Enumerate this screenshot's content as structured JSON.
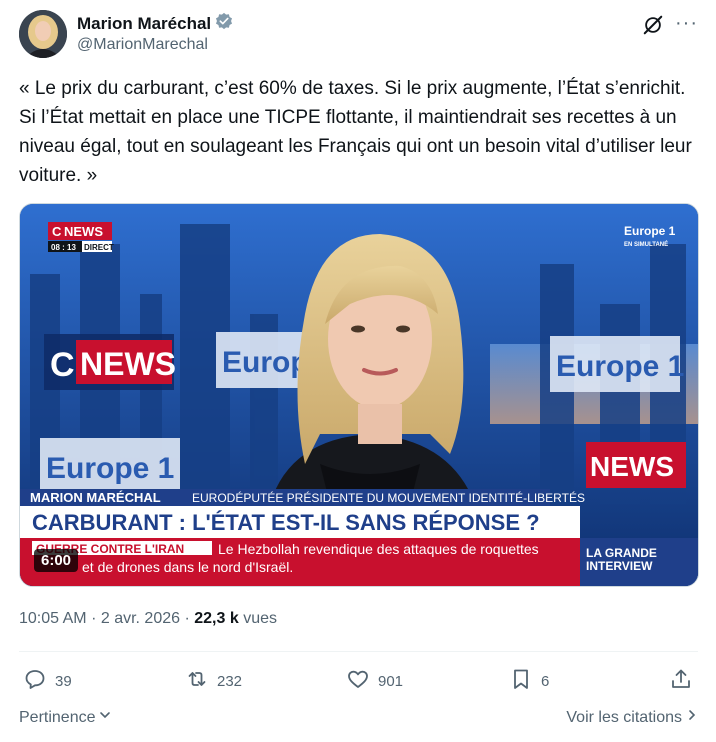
{
  "author": {
    "name": "Marion Maréchal",
    "handle": "@MarionMarechal",
    "verified_color": "#829aab"
  },
  "tweet": {
    "text": "« Le prix du carburant, c’est 60% de taxes. Si le prix augmente, l’État s’enrichit. Si l’État mettait en place une TICPE flottante, il maintiendrait ses recettes à un niveau égal, tout en soulageant les Français qui ont un besoin vital d’utiliser leur voiture. »"
  },
  "media": {
    "duration": "6:00",
    "channel_logo": "NEWS",
    "channel_logo_prefix": "C",
    "clock": "08 : 13",
    "live_label": "DIRECT",
    "partner_logo": "Europe 1",
    "partner_sub": "EN SIMULTANÉ",
    "backdrop_logos": [
      "NEWS",
      "Europe",
      "Europe 1",
      "Europe 1",
      "NEWS"
    ],
    "lower_third_name": "MARION MARÉCHAL",
    "lower_third_role": "EURODÉPUTÉE PRÉSIDENTE DU MOUVEMENT IDENTITÉ-LIBERTÉS",
    "headline": "CARBURANT : L'ÉTAT EST-IL SANS RÉPONSE ?",
    "ticker_tag": "GUERRE CONTRE L'IRAN",
    "ticker_text_line1": "Le Hezbollah revendique des attaques de roquettes",
    "ticker_text_line2": "et de drones dans le nord d'Israël.",
    "program_line1": "LA GRANDE",
    "program_line2": "INTERVIEW"
  },
  "meta": {
    "time": "10:05 AM",
    "date": "2 avr. 2026",
    "views_count": "22,3 k",
    "views_label": "vues",
    "separator": "·"
  },
  "actions": {
    "replies": "39",
    "reposts": "232",
    "likes": "901",
    "bookmarks": "6"
  },
  "footer": {
    "sort_label": "Pertinence",
    "quotes_label": "Voir les citations"
  },
  "colors": {
    "text": "#0f1419",
    "secondary": "#536471",
    "red_banner": "#c8102e",
    "studio_blue": "#1b4a9a"
  }
}
